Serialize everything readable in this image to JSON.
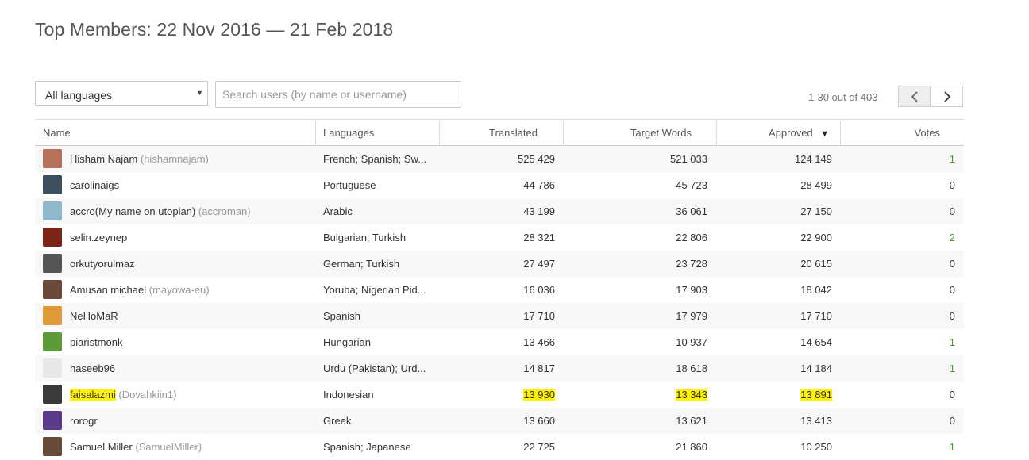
{
  "page": {
    "title": "Top Members: 22 Nov 2016 — 21 Feb 2018"
  },
  "filters": {
    "language_selected": "All languages",
    "search_placeholder": "Search users (by name or username)"
  },
  "pagination": {
    "range_text": "1-30 out of 403",
    "prev_icon": "chevron-left-icon",
    "next_icon": "chevron-right-icon"
  },
  "table": {
    "columns": {
      "name": "Name",
      "languages": "Languages",
      "translated": "Translated",
      "target_words": "Target Words",
      "approved": "Approved",
      "votes": "Votes"
    },
    "sort_indicator": "▼",
    "rows": [
      {
        "name": "Hisham Najam",
        "username": "(hishamnajam)",
        "languages": "French; Spanish; Sw...",
        "translated": "525 429",
        "target_words": "521 033",
        "approved": "124 149",
        "votes": "1",
        "vote_color": "green",
        "avatar_color": "#b5715a"
      },
      {
        "name": "carolinaigs",
        "username": "",
        "languages": "Portuguese",
        "translated": "44 786",
        "target_words": "45 723",
        "approved": "28 499",
        "votes": "0",
        "vote_color": "",
        "avatar_color": "#3d4f5c"
      },
      {
        "name": "accro(My name on utopian)",
        "username": "(accroman)",
        "languages": "Arabic",
        "translated": "43 199",
        "target_words": "36 061",
        "approved": "27 150",
        "votes": "0",
        "vote_color": "",
        "avatar_color": "#8fb8cc"
      },
      {
        "name": "selin.zeynep",
        "username": "",
        "languages": "Bulgarian; Turkish",
        "translated": "28 321",
        "target_words": "22 806",
        "approved": "22 900",
        "votes": "2",
        "vote_color": "green",
        "avatar_color": "#7a2418"
      },
      {
        "name": "orkutyorulmaz",
        "username": "",
        "languages": "German; Turkish",
        "translated": "27 497",
        "target_words": "23 728",
        "approved": "20 615",
        "votes": "0",
        "vote_color": "",
        "avatar_color": "#555555"
      },
      {
        "name": "Amusan michael",
        "username": "(mayowa-eu)",
        "languages": "Yoruba; Nigerian Pid...",
        "translated": "16 036",
        "target_words": "17 903",
        "approved": "18 042",
        "votes": "0",
        "vote_color": "",
        "avatar_color": "#6b4a3a"
      },
      {
        "name": "NeHoMaR",
        "username": "",
        "languages": "Spanish",
        "translated": "17 710",
        "target_words": "17 979",
        "approved": "17 710",
        "votes": "0",
        "vote_color": "",
        "avatar_color": "#e09a3a"
      },
      {
        "name": "piaristmonk",
        "username": "",
        "languages": "Hungarian",
        "translated": "13 466",
        "target_words": "10 937",
        "approved": "14 654",
        "votes": "1",
        "vote_color": "green",
        "avatar_color": "#5c9a3a"
      },
      {
        "name": "haseeb96",
        "username": "",
        "languages": "Urdu (Pakistan); Urd...",
        "translated": "14 817",
        "target_words": "18 618",
        "approved": "14 184",
        "votes": "1",
        "vote_color": "green",
        "avatar_color": "#e8e8e8"
      },
      {
        "name": "faisalazmi",
        "username": "(Dovahkiin1)",
        "languages": "Indonesian",
        "translated": "13 930",
        "target_words": "13 343",
        "approved": "13 891",
        "votes": "0",
        "vote_color": "",
        "avatar_color": "#3a3a3a",
        "highlighted": true
      },
      {
        "name": "rorogr",
        "username": "",
        "languages": "Greek",
        "translated": "13 660",
        "target_words": "13 621",
        "approved": "13 413",
        "votes": "0",
        "vote_color": "",
        "avatar_color": "#5a3a8a"
      },
      {
        "name": "Samuel Miller",
        "username": "(SamuelMiller)",
        "languages": "Spanish; Japanese",
        "translated": "22 725",
        "target_words": "21 860",
        "approved": "10 250",
        "votes": "1",
        "vote_color": "green",
        "avatar_color": "#6a4a3a"
      }
    ]
  }
}
